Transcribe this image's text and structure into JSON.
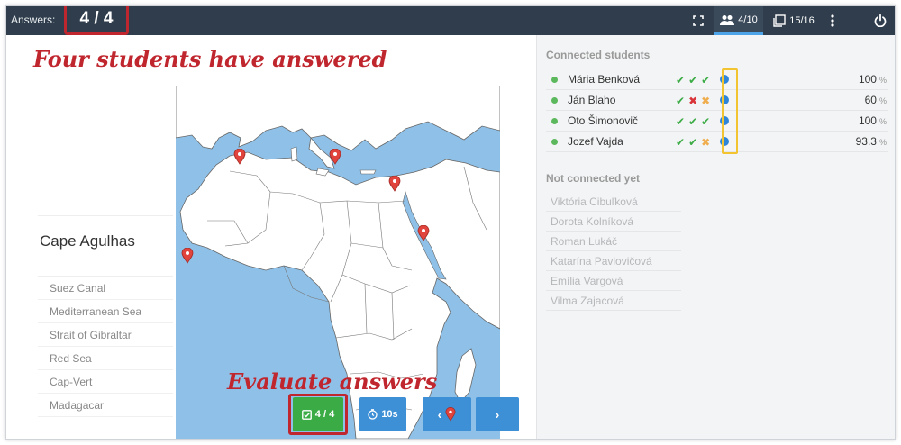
{
  "header": {
    "answers_label": "Answers:",
    "answers_count": "4 / 4",
    "students_count": "4/10",
    "slides_count": "15/16"
  },
  "annotations": {
    "top": "Four students have answered",
    "bottom": "Evaluate answers"
  },
  "question": {
    "title": "Cape Agulhas",
    "choices": [
      "Suez Canal",
      "Mediterranean Sea",
      "Strait of Gibraltar",
      "Red Sea",
      "Cap-Vert",
      "Madagacar"
    ]
  },
  "buttons": {
    "evaluate_label": "4 / 4",
    "timer_label": "10s"
  },
  "students": {
    "connected_title": "Connected students",
    "connected": [
      {
        "name": "Mária Benková",
        "marks": [
          "ok",
          "ok",
          "ok"
        ],
        "score": "100",
        "unit": "%"
      },
      {
        "name": "Ján Blaho",
        "marks": [
          "ok",
          "bad",
          "part"
        ],
        "score": "60",
        "unit": "%"
      },
      {
        "name": "Oto Šimonovič",
        "marks": [
          "ok",
          "ok",
          "ok"
        ],
        "score": "100",
        "unit": "%"
      },
      {
        "name": "Jozef Vajda",
        "marks": [
          "ok",
          "ok",
          "part"
        ],
        "score": "93.3",
        "unit": "%"
      }
    ],
    "not_connected_title": "Not connected yet",
    "not_connected": [
      "Viktória Cibuľková",
      "Dorota Kolníková",
      "Roman Lukáč",
      "Katarína Pavlovičová",
      "Emília Vargová",
      "Vilma Zajacová"
    ]
  },
  "colors": {
    "topbar": "#2f3d4c",
    "accent_red": "#c0262d",
    "green": "#3bab45",
    "blue": "#3d8fd6",
    "sea": "#8fc1e8"
  }
}
